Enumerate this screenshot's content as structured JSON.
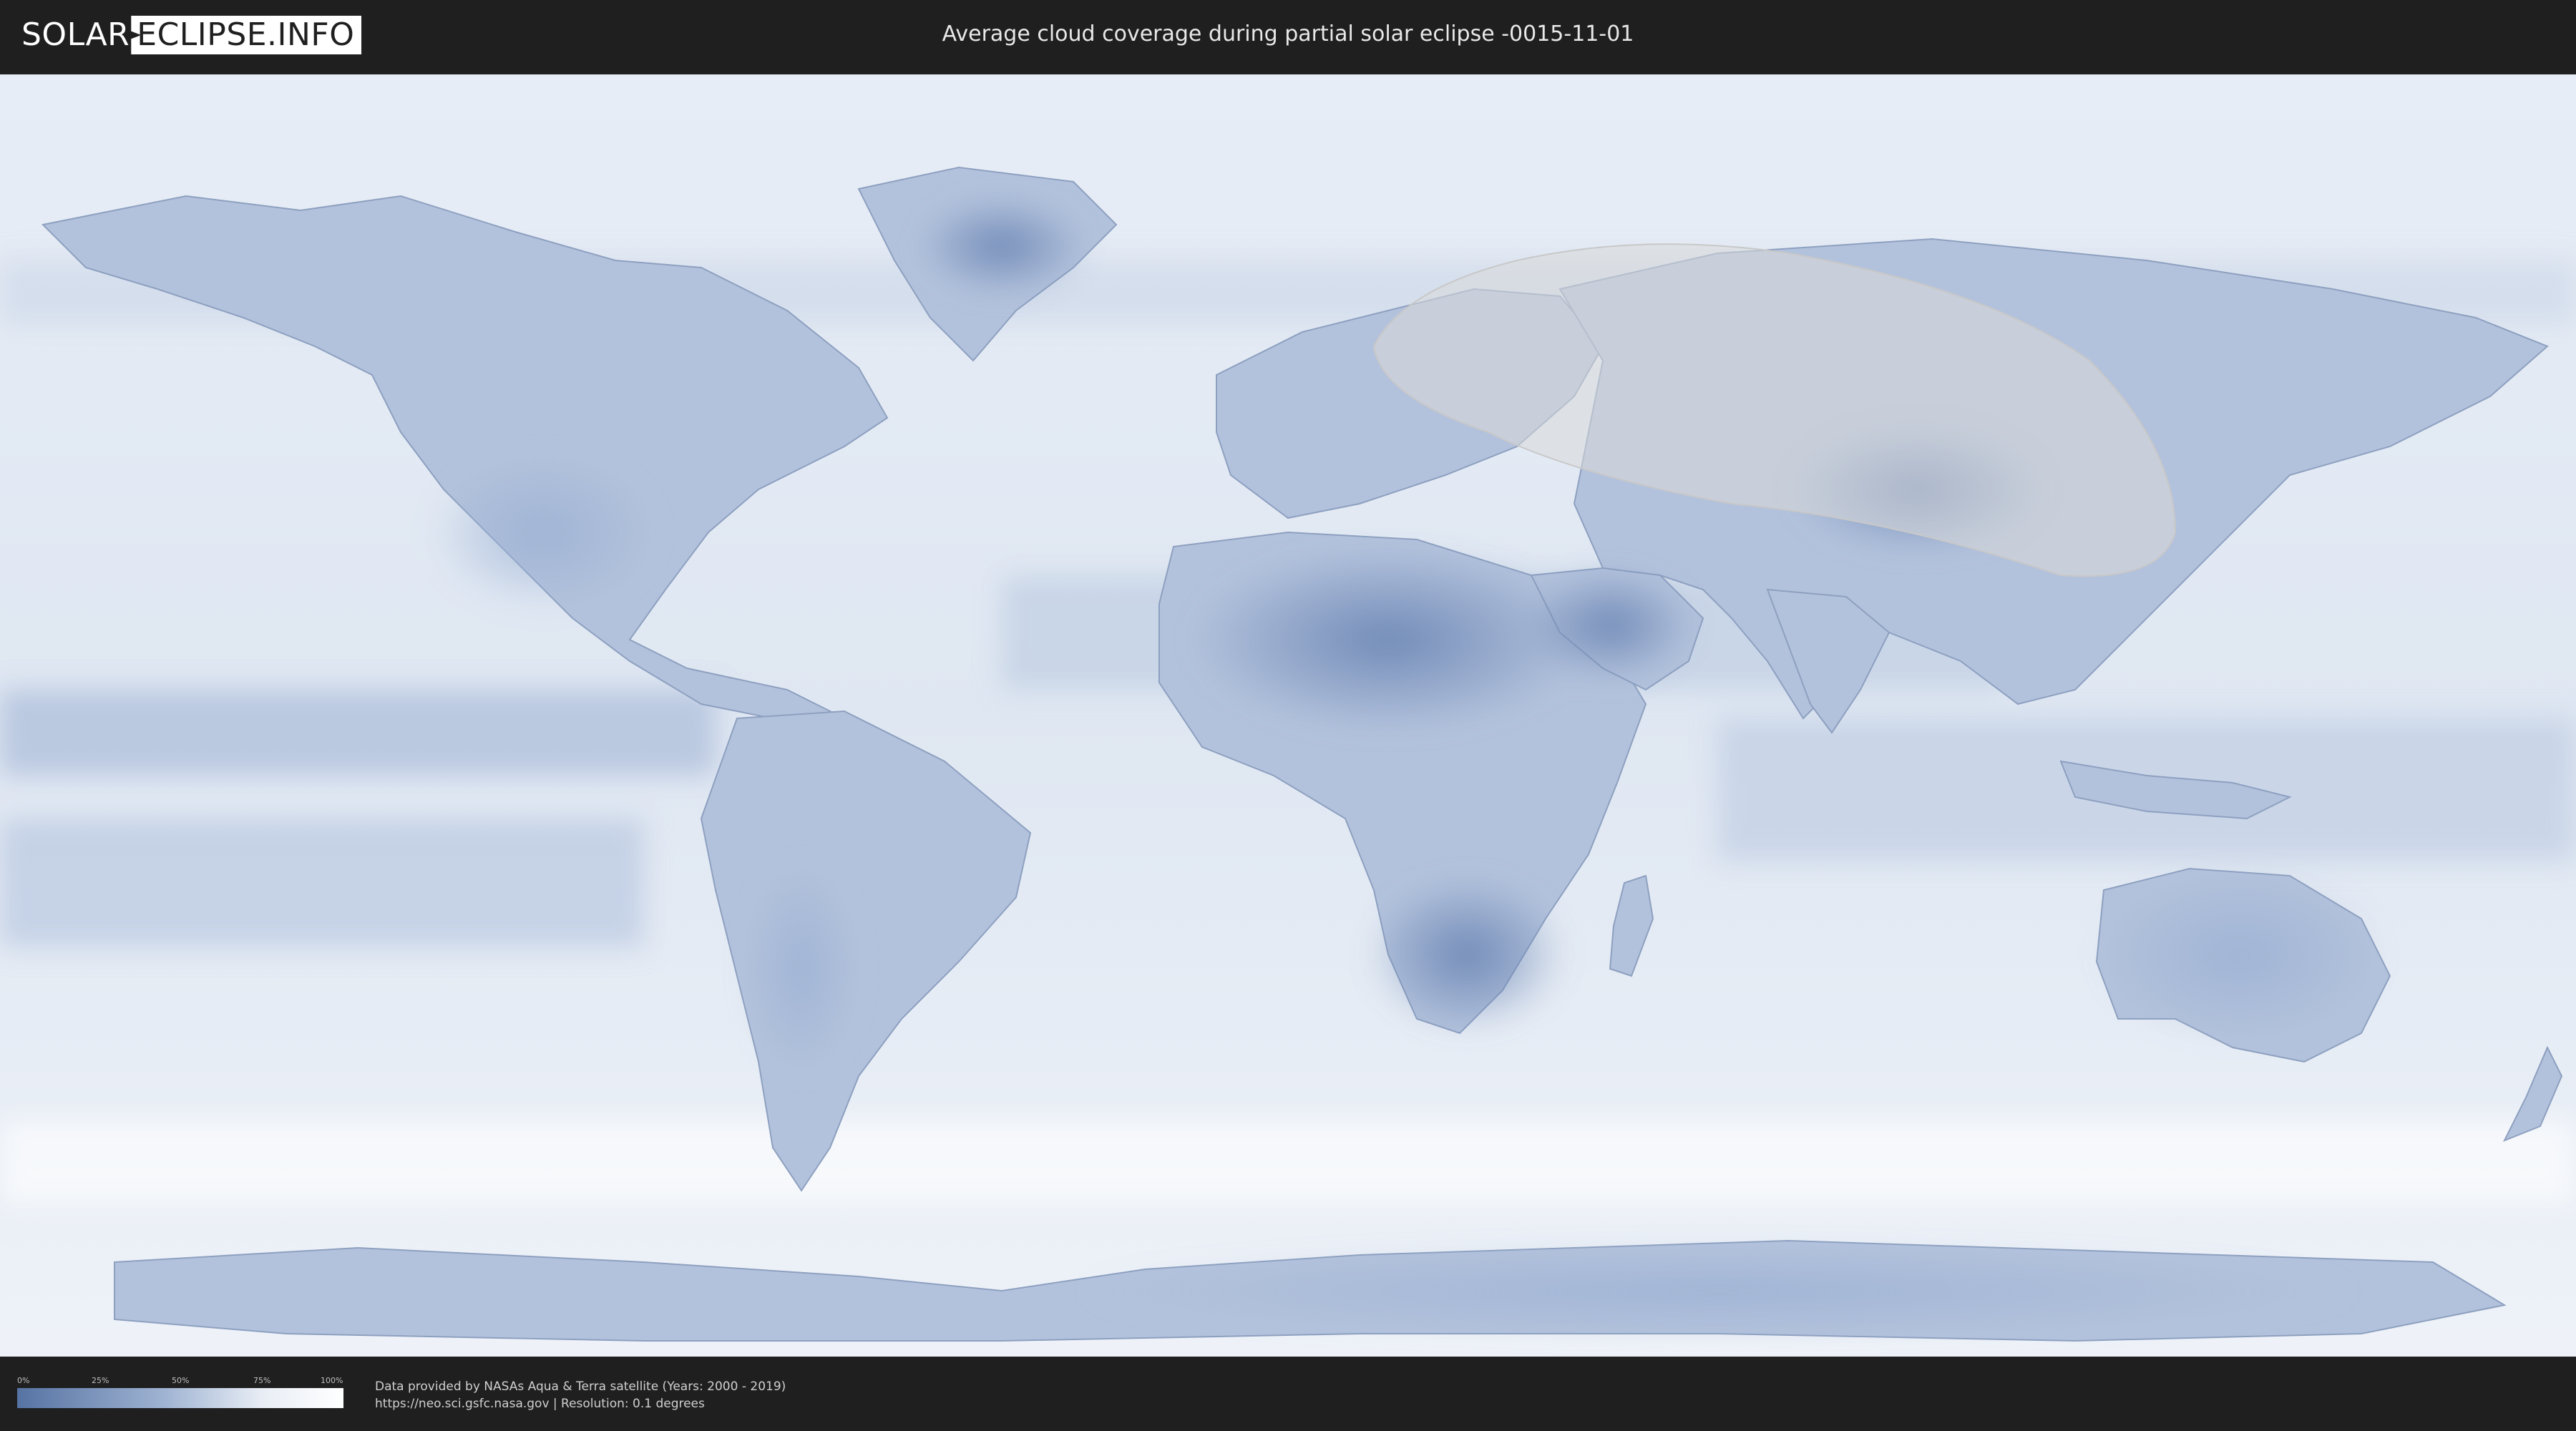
{
  "logo": {
    "left": "SOLAR",
    "right": "ECLIPSE.INFO"
  },
  "header": {
    "title": "Average cloud coverage during partial solar eclipse -0015-11-01"
  },
  "legend": {
    "ticks": [
      "0%",
      "25%",
      "50%",
      "75%",
      "100%"
    ],
    "gradient_colors": [
      "#5673a3",
      "#9fb3d2",
      "#e8edf5",
      "#ffffff"
    ]
  },
  "footer": {
    "source": "Data provided by NASAs Aqua & Terra satellite (Years: 2000 - 2019)",
    "details": "https://neo.sci.gsfc.nasa.gov | Resolution: 0.1 degrees"
  },
  "colors": {
    "background": "#1f1f1f",
    "clear_sky": "#5673a3",
    "full_cloud": "#ffffff",
    "eclipse_overlay": "#d8d8d8"
  }
}
